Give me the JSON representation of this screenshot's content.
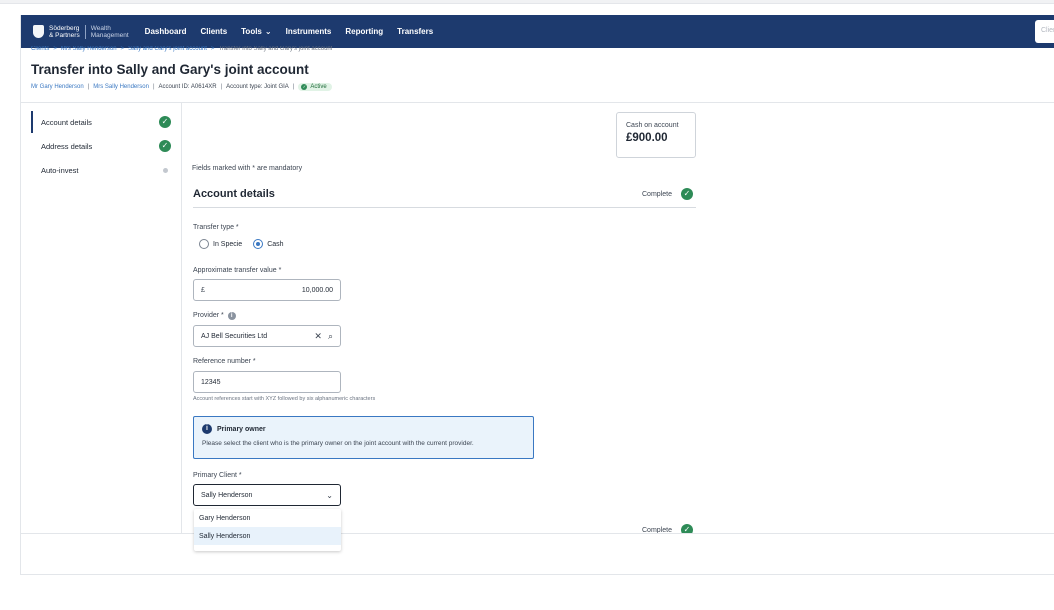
{
  "nav": {
    "brand_line1": "Söderberg",
    "brand_line2": "& Partners",
    "brand_line3": "Wealth",
    "brand_line4": "Management",
    "items": [
      {
        "label": "Dashboard"
      },
      {
        "label": "Clients"
      },
      {
        "label": "Tools"
      },
      {
        "label": "Instruments"
      },
      {
        "label": "Reporting"
      },
      {
        "label": "Transfers"
      }
    ],
    "search_placeholder": "Clien"
  },
  "breadcrumb": {
    "items": [
      "Clients",
      "Mrs Sally Henderson",
      "Sally and Gary's joint account"
    ],
    "current": "Transfer into Sally and Gary's joint account"
  },
  "page": {
    "title": "Transfer into Sally and Gary's joint account",
    "owner1": "Mr Gary Henderson",
    "owner2": "Mrs Sally Henderson",
    "account_id": "Account ID: A0614XR",
    "account_type": "Account type: Joint GIA",
    "status": "Active"
  },
  "sidebar": {
    "items": [
      {
        "label": "Account details"
      },
      {
        "label": "Address details"
      },
      {
        "label": "Auto-invest"
      }
    ]
  },
  "cash": {
    "label": "Cash on account",
    "value": "£900.00"
  },
  "form": {
    "mandatory_note": "Fields marked with * are mandatory",
    "section_title": "Account details",
    "complete_label": "Complete",
    "transfer_type_label": "Transfer type *",
    "option_in_specie": "In Specie",
    "option_cash": "Cash",
    "transfer_value_label": "Approximate transfer value *",
    "currency_prefix": "£",
    "transfer_value": "10,000.00",
    "provider_label": "Provider *",
    "provider_value": "AJ Bell Securities Ltd",
    "reference_label": "Reference number *",
    "reference_value": "12345",
    "reference_hint": "Account references start with XYZ followed by six alphanumeric characters",
    "notice_title": "Primary owner",
    "notice_text": "Please select the client who is the primary owner on the joint account with the current provider.",
    "primary_client_label": "Primary Client *",
    "primary_client_value": "Sally Henderson",
    "dropdown_options": [
      "Gary Henderson",
      "Sally Henderson"
    ],
    "next_section_complete": "Complete"
  },
  "colors": {
    "nav_bg": "#1d3a6e",
    "accent": "#3a78c2",
    "success": "#2e8b57"
  }
}
